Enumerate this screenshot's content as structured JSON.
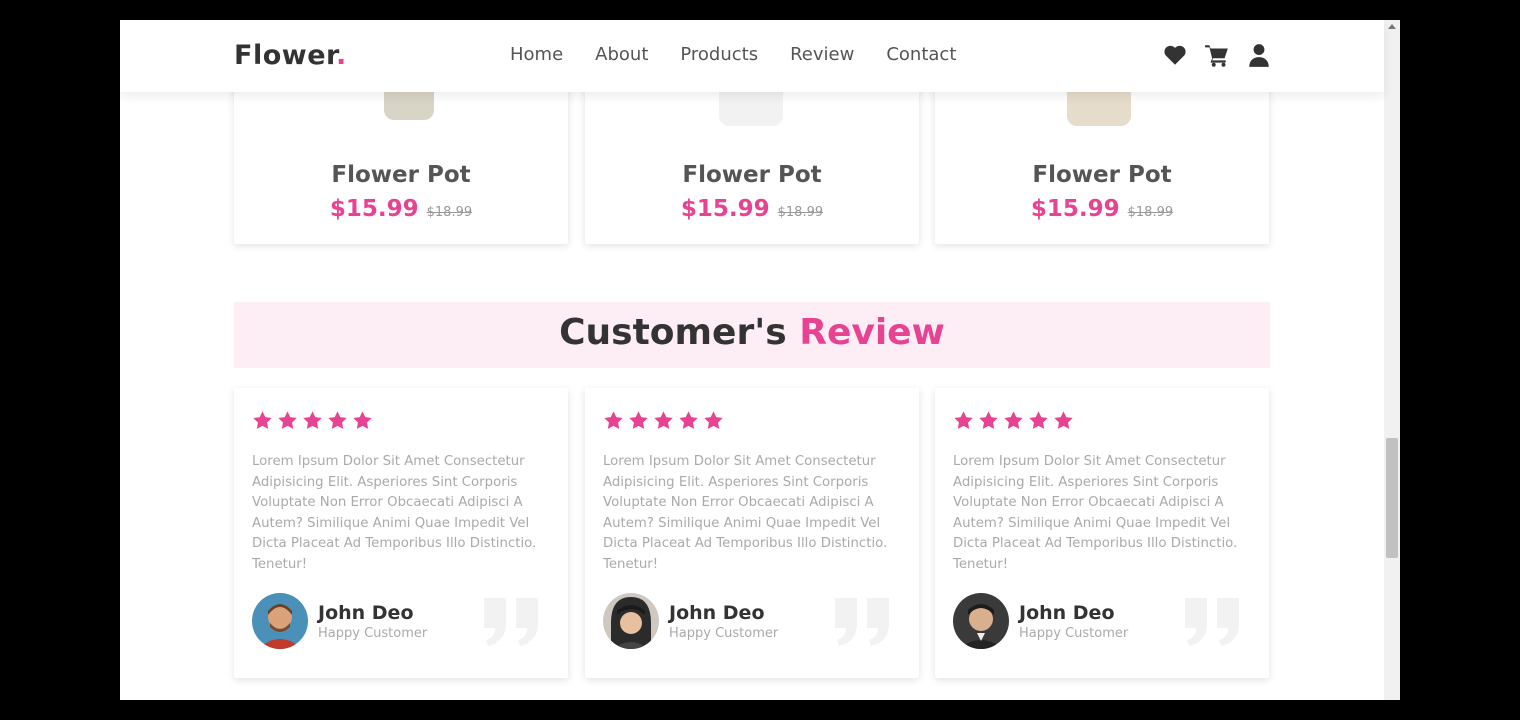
{
  "brand": {
    "name": "Flower",
    "dot": "."
  },
  "nav": {
    "links": [
      "Home",
      "About",
      "Products",
      "Review",
      "Contact"
    ]
  },
  "icons": [
    "heart-icon",
    "cart-icon",
    "user-icon"
  ],
  "products": [
    {
      "name": "Flower Pot",
      "price": "$15.99",
      "old_price": "$18.99"
    },
    {
      "name": "Flower Pot",
      "price": "$15.99",
      "old_price": "$18.99"
    },
    {
      "name": "Flower Pot",
      "price": "$15.99",
      "old_price": "$18.99"
    }
  ],
  "section": {
    "heading_main": "Customer's",
    "heading_accent": "Review"
  },
  "reviews": [
    {
      "stars": 5,
      "text": "Lorem Ipsum Dolor Sit Amet Consectetur Adipisicing Elit. Asperiores Sint Corporis Voluptate Non Error Obcaecati Adipisci A Autem? Similique Animi Quae Impedit Vel Dicta Placeat Ad Temporibus Illo Distinctio. Tenetur!",
      "name": "John Deo",
      "role": "Happy Customer"
    },
    {
      "stars": 5,
      "text": "Lorem Ipsum Dolor Sit Amet Consectetur Adipisicing Elit. Asperiores Sint Corporis Voluptate Non Error Obcaecati Adipisci A Autem? Similique Animi Quae Impedit Vel Dicta Placeat Ad Temporibus Illo Distinctio. Tenetur!",
      "name": "John Deo",
      "role": "Happy Customer"
    },
    {
      "stars": 5,
      "text": "Lorem Ipsum Dolor Sit Amet Consectetur Adipisicing Elit. Asperiores Sint Corporis Voluptate Non Error Obcaecati Adipisci A Autem? Similique Animi Quae Impedit Vel Dicta Placeat Ad Temporibus Illo Distinctio. Tenetur!",
      "name": "John Deo",
      "role": "Happy Customer"
    }
  ],
  "colors": {
    "accent": "#e84393",
    "text_dark": "#333333",
    "banner_bg": "#fdeef5"
  }
}
